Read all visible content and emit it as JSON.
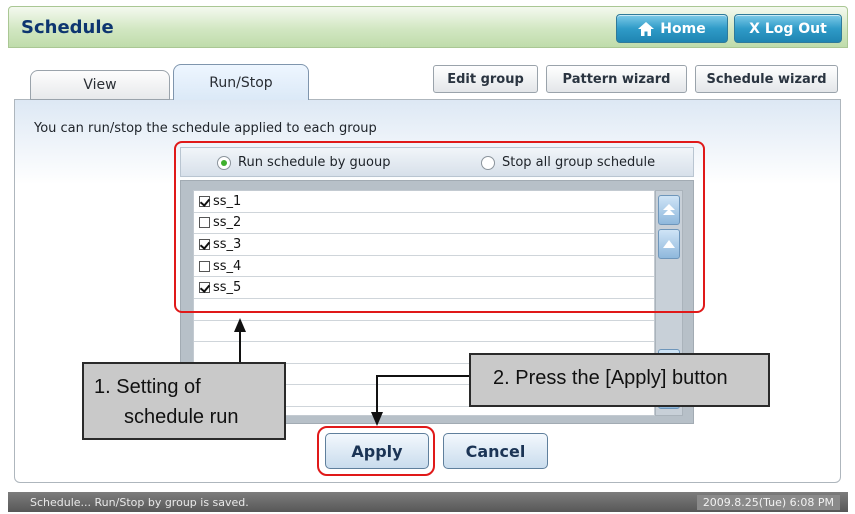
{
  "header": {
    "title": "Schedule",
    "home_label": "Home",
    "logout_label": "X Log Out"
  },
  "tabs": [
    {
      "label": "View"
    },
    {
      "label": "Run/Stop"
    }
  ],
  "toolbar": {
    "edit_group": "Edit group",
    "pattern_wizard": "Pattern wizard",
    "schedule_wizard": "Schedule wizard"
  },
  "main": {
    "instruction": "You can run/stop the schedule applied to each group",
    "radio_run": "Run schedule by guoup",
    "radio_stop": "Stop all group schedule",
    "groups": [
      {
        "name": "ss_1",
        "checked": true
      },
      {
        "name": "ss_2",
        "checked": false
      },
      {
        "name": "ss_3",
        "checked": true
      },
      {
        "name": "ss_4",
        "checked": false
      },
      {
        "name": "ss_5",
        "checked": true
      }
    ],
    "apply_label": "Apply",
    "cancel_label": "Cancel"
  },
  "callouts": {
    "one_line1": "1. Setting of",
    "one_line2": "schedule run",
    "two": "2. Press the [Apply] button"
  },
  "status": {
    "message": "Schedule... Run/Stop by group is saved.",
    "datetime": "2009.8.25(Tue)  6:08 PM"
  },
  "colors": {
    "highlight": "#e01919",
    "title_text": "#0d3570",
    "radio_selected": "#3fb02d"
  }
}
